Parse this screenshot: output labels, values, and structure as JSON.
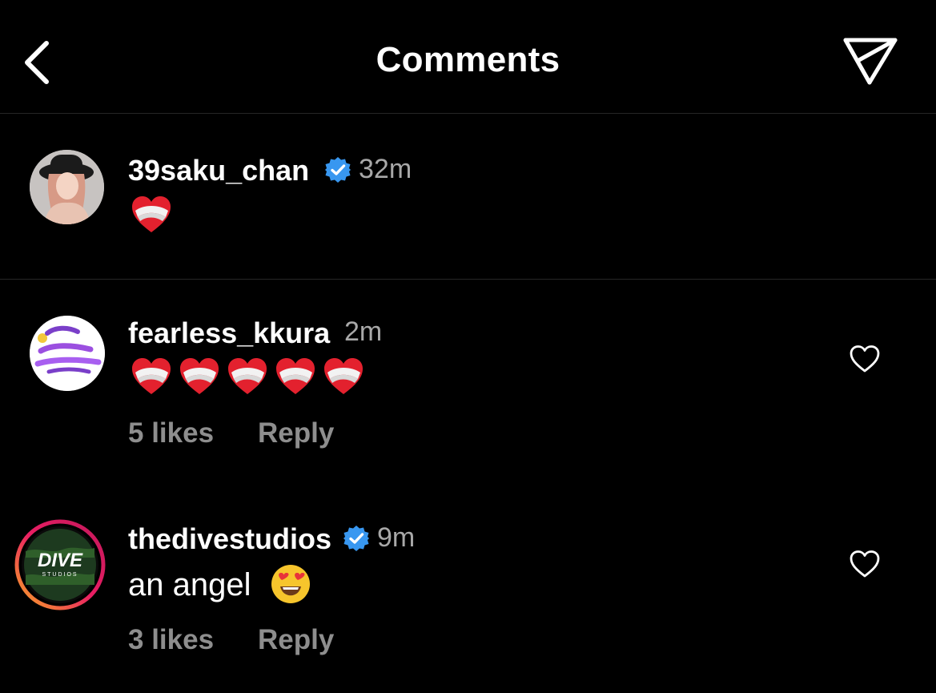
{
  "header": {
    "title": "Comments",
    "back_icon": "chevron-left-icon",
    "share_icon": "paper-plane-icon"
  },
  "colors": {
    "background": "#000000",
    "divider": "#262626",
    "secondary_text": "#a8a8a8",
    "meta_text": "#8e8e8e",
    "verified_badge": "#3897f0"
  },
  "caption": {
    "username": "39saku_chan",
    "verified": true,
    "time": "32m",
    "text_emoji": "mending-heart-emoji"
  },
  "comments": [
    {
      "username": "fearless_kkura",
      "verified": false,
      "time": "2m",
      "emoji_count": 5,
      "emoji": "mending-heart-emoji",
      "likes": "5 likes",
      "reply": "Reply"
    },
    {
      "username": "thedivestudios",
      "verified": true,
      "time": "9m",
      "text": "an angel",
      "emoji": "heart-eyes-emoji",
      "avatar_text": "DIVE",
      "avatar_subtext": "STUDIOS",
      "likes": "3 likes",
      "reply": "Reply"
    }
  ]
}
